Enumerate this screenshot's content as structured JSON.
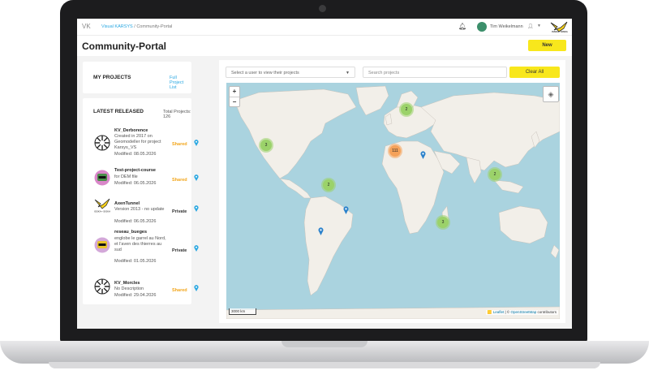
{
  "header": {
    "logo": "VK",
    "breadcrumb": [
      "Visual KARSYS",
      "Community-Portal"
    ],
    "breadcrumb_sep": "/",
    "username": "Tim Weikelmann",
    "brand_text": "ISSKA • SISKA"
  },
  "page": {
    "title": "Community-Portal",
    "new_label": "New"
  },
  "my_projects": {
    "title": "MY PROJECTS",
    "link": "Full Project List"
  },
  "latest": {
    "title": "LATEST RELEASED",
    "total": "Total Projects: 126",
    "items": [
      {
        "name": "KV_Derborence",
        "desc": "Created in 2017 on Geomodeller for project Karsys_VS",
        "modified": "Modified: 08.05.2026",
        "status": "Shared"
      },
      {
        "name": "Test-project-course",
        "desc": "for DEM file",
        "modified": "Modified: 06.05.2026",
        "status": "Shared"
      },
      {
        "name": "AxenTunnel",
        "desc": "Version 2013 - no update",
        "modified": "Modified: 06.05.2026",
        "status": "Private"
      },
      {
        "name": "reseau_bueges",
        "desc": "englobe le garrel au Nord, et l'aven des thierres au sud",
        "modified": "Modified: 01.05.2026",
        "status": "Private"
      },
      {
        "name": "KV_Morcles",
        "desc": "No Description",
        "modified": "Modified: 29.04.2026",
        "status": "Shared"
      }
    ]
  },
  "filters": {
    "user_select_placeholder": "Select a user to view their projects",
    "search_placeholder": "Search projects",
    "clear_label": "Clear All"
  },
  "map": {
    "zoom_in": "+",
    "zoom_out": "−",
    "scale": "3000 km",
    "attribution_prefix": "🟨 ",
    "attribution_leaflet": "Leaflet",
    "attribution_mid": " | © ",
    "attribution_osm": "OpenStreetMap",
    "attribution_suffix": " contributors",
    "clusters": [
      "2",
      "3",
      "111",
      "2",
      "2",
      "3"
    ]
  },
  "colors": {
    "accent_yellow": "#f8e71c",
    "shared_orange": "#f2a51a",
    "link_blue": "#29a7e1",
    "ocean": "#aad3df",
    "land": "#f2efe9"
  }
}
